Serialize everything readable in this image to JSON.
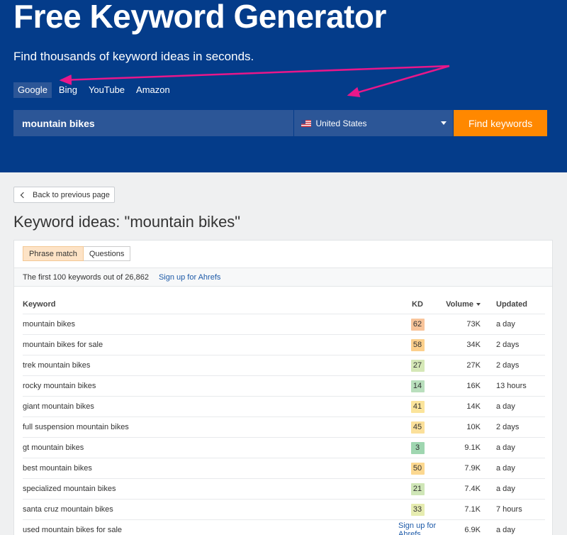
{
  "hero": {
    "title": "Free Keyword Generator",
    "subtitle": "Find thousands of keyword ideas in seconds."
  },
  "tabs": [
    "Google",
    "Bing",
    "YouTube",
    "Amazon"
  ],
  "active_tab": "Google",
  "search": {
    "value": "mountain bikes",
    "country": "United States",
    "button": "Find keywords"
  },
  "back_button": "Back to previous page",
  "ideas_title": "Keyword ideas: \"mountain bikes\"",
  "toggle": {
    "phrase": "Phrase match",
    "questions": "Questions"
  },
  "info": {
    "text": "The first 100 keywords out of 26,862",
    "signup": "Sign up for Ahrefs"
  },
  "table": {
    "headers": {
      "keyword": "Keyword",
      "kd": "KD",
      "volume": "Volume",
      "updated": "Updated"
    },
    "rows": [
      {
        "keyword": "mountain bikes",
        "kd": "62",
        "kd_color": "#f8c49a",
        "volume": "73K",
        "updated": "a day"
      },
      {
        "keyword": "mountain bikes for sale",
        "kd": "58",
        "kd_color": "#fcd08c",
        "volume": "34K",
        "updated": "2 days"
      },
      {
        "keyword": "trek mountain bikes",
        "kd": "27",
        "kd_color": "#d5e8b7",
        "volume": "27K",
        "updated": "2 days"
      },
      {
        "keyword": "rocky mountain bikes",
        "kd": "14",
        "kd_color": "#b9dfbd",
        "volume": "16K",
        "updated": "13 hours"
      },
      {
        "keyword": "giant mountain bikes",
        "kd": "41",
        "kd_color": "#fbe49b",
        "volume": "14K",
        "updated": "a day"
      },
      {
        "keyword": "full suspension mountain bikes",
        "kd": "45",
        "kd_color": "#fbe09a",
        "volume": "10K",
        "updated": "2 days"
      },
      {
        "keyword": "gt mountain bikes",
        "kd": "3",
        "kd_color": "#9fd6b0",
        "volume": "9.1K",
        "updated": "a day"
      },
      {
        "keyword": "best mountain bikes",
        "kd": "50",
        "kd_color": "#fcd890",
        "volume": "7.9K",
        "updated": "a day"
      },
      {
        "keyword": "specialized mountain bikes",
        "kd": "21",
        "kd_color": "#cfe6b7",
        "volume": "7.4K",
        "updated": "a day"
      },
      {
        "keyword": "santa cruz mountain bikes",
        "kd": "33",
        "kd_color": "#e6ecb0",
        "volume": "7.1K",
        "updated": "7 hours"
      },
      {
        "keyword": "used mountain bikes for sale",
        "kd": "",
        "kd_link": "Sign up for Ahrefs",
        "volume": "6.9K",
        "updated": "a day"
      }
    ]
  },
  "colors": {
    "hero_bg": "#043c8a",
    "accent_orange": "#ff8800",
    "annotation_pink": "#e8178a"
  }
}
